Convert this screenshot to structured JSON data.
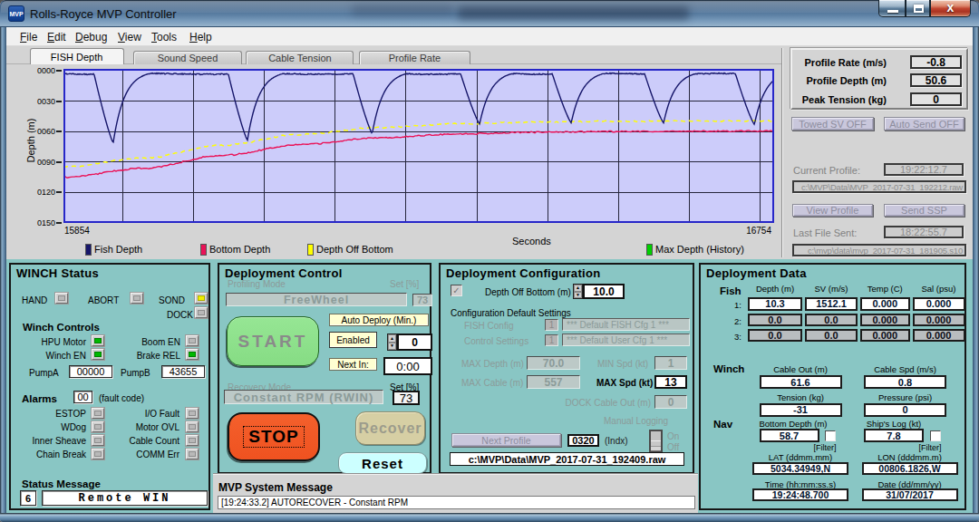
{
  "window": {
    "title": "Rolls-Royce MVP Controller",
    "icon": "MVP",
    "buttons": {
      "minimize": "minimize",
      "maximize": "maximize",
      "close": "close"
    }
  },
  "menu": {
    "items": [
      "File",
      "Edit",
      "Debug",
      "View",
      "Tools",
      "Help"
    ]
  },
  "tabs": [
    {
      "label": "FISH Depth",
      "active": true
    },
    {
      "label": "Sound Speed",
      "active": false
    },
    {
      "label": "Cable Tension",
      "active": false
    },
    {
      "label": "Profile Rate",
      "active": false
    }
  ],
  "chart_data": {
    "type": "line",
    "xlabel": "Seconds",
    "ylabel": "Depth (m)",
    "x_range": [
      15854,
      16754
    ],
    "x_tick_labels": [
      "15854",
      "16754"
    ],
    "y_ticks": [
      "0000",
      "0030",
      "0060",
      "0090",
      "0120",
      "0150"
    ],
    "y_range_m": [
      0,
      150
    ],
    "x_gridlines": 10,
    "plot_bg": "#ccccfa",
    "grid_color": "#26263c",
    "border_color": "#2626c8",
    "series": [
      {
        "name": "Fish Depth",
        "color": "#16166a",
        "surface_depth_m": 3.2,
        "dives": [
          {
            "t": 15917,
            "depth_m": 71.0
          },
          {
            "t": 16087,
            "depth_m": 68.5
          },
          {
            "t": 16245,
            "depth_m": 62.0
          },
          {
            "t": 16381,
            "depth_m": 52.5
          },
          {
            "t": 16497,
            "depth_m": 51.5
          },
          {
            "t": 16614,
            "depth_m": 51.5
          },
          {
            "t": 16729,
            "depth_m": 53.0
          }
        ]
      },
      {
        "name": "Bottom Depth",
        "color": "#ea1257",
        "t": [
          15854,
          15954,
          16054,
          16154,
          16254,
          16354,
          16454,
          16554,
          16654,
          16754
        ],
        "depth_m": [
          105.0,
          96.3,
          83.5,
          72.8,
          66.0,
          62.3,
          60.6,
          59.9,
          59.6,
          59.5
        ]
      },
      {
        "name": "Depth Off Bottom",
        "color": "#ffff00",
        "dashed": true,
        "offset_from_bottom_m": -10
      },
      {
        "name": "Max Depth (History)",
        "color": "#00cf00",
        "visible": false
      }
    ],
    "legend": [
      {
        "label": "Fish Depth",
        "color": "#16166a"
      },
      {
        "label": "Bottom Depth",
        "color": "#ea1257"
      },
      {
        "label": "Depth Off Bottom",
        "color": "#ffff00"
      },
      {
        "label": "Max Depth (History)",
        "color": "#00cf00"
      }
    ]
  },
  "profile_panel": {
    "readouts": [
      {
        "label": "Profile Rate (m/s)",
        "value": "-0.8"
      },
      {
        "label": "Profile Depth (m)",
        "value": "50.6"
      },
      {
        "label": "Peak Tension (kg)",
        "value": "0"
      }
    ],
    "towed_sv_button": "Towed SV OFF",
    "auto_send_button": "Auto Send  OFF",
    "current_profile_label": "Current Profile:",
    "current_profile_time": "19:22:12.7",
    "current_profile_file": "c:\\MVP\\Data\\MVP_2017-07-31_192212.raw",
    "view_profile_button": "View Profile",
    "send_ssp_button": "Send SSP",
    "last_file_label": "Last File Sent:",
    "last_file_time": "18:22:55.7",
    "last_file_path": "c:\\mvp\\data\\mvp_2017-07-31_181905.s10"
  },
  "winch": {
    "title": "WINCH Status",
    "indicators": [
      {
        "label": "HAND",
        "state": "off"
      },
      {
        "label": "ABORT",
        "state": "off"
      },
      {
        "label": "SOND",
        "state": "yellow"
      },
      {
        "label": "DOCK",
        "state": "off"
      }
    ],
    "controls_title": "Winch Controls",
    "controls": [
      {
        "label": "HPU Motor",
        "state": "green"
      },
      {
        "label": "Boom EN",
        "state": "off"
      },
      {
        "label": "Winch EN",
        "state": "green"
      },
      {
        "label": "Brake REL",
        "state": "green"
      }
    ],
    "pump_a_label": "PumpA",
    "pump_a_value": "00000",
    "pump_b_label": "PumpB",
    "pump_b_value": "43655",
    "alarms_title": "Alarms",
    "fault_code": "00",
    "fault_code_note": "(fault code)",
    "alarms": [
      {
        "label": "ESTOP",
        "state": "off"
      },
      {
        "label": "I/O Fault",
        "state": "off"
      },
      {
        "label": "WDog",
        "state": "off"
      },
      {
        "label": "Motor OVL",
        "state": "off"
      },
      {
        "label": "Inner Sheave",
        "state": "off"
      },
      {
        "label": "Cable Count",
        "state": "off"
      },
      {
        "label": "Chain Break",
        "state": "off"
      },
      {
        "label": "COMM Err",
        "state": "off"
      }
    ],
    "status_title": "Status Message",
    "status_code": "6",
    "status_text": "Remote WIN"
  },
  "control": {
    "title": "Deployment Control",
    "profiling_mode_label": "Profiling Mode",
    "profiling_set_label": "Set [%]",
    "profiling_mode": "FreeWheel",
    "profiling_set": "73",
    "start_button": "START",
    "auto_deploy_label": "Auto Deploy (Min.)",
    "enabled_label": "Enabled",
    "auto_deploy_value": "0",
    "next_in_label": "Next In:",
    "next_in_value": "0:00",
    "recovery_mode_label": "Recovery Mode",
    "recovery_set_label": "Set [%]",
    "recovery_mode": "Constant RPM (RWIN)",
    "recovery_set": "73",
    "stop_button": "STOP",
    "recover_button": "Recover",
    "reset_button": "Reset"
  },
  "config": {
    "title": "Deployment Configuration",
    "depth_off_bottom_label": "Depth Off Bottom (m)",
    "depth_off_bottom_checked": true,
    "depth_off_bottom_value": "10.0",
    "defaults_title": "Configuration Default Settings",
    "fish_config_label": "FISH Config",
    "fish_config_index": "1",
    "fish_config_name": "*** Default FISH Cfg 1 ***",
    "control_settings_label": "Control Settings",
    "control_settings_index": "1",
    "control_settings_name": "*** Default User Cfg 1 ***",
    "max_depth_label": "MAX Depth (m)",
    "max_depth_value": "70.0",
    "min_spd_label": "MIN Spd (kt)",
    "min_spd_value": "1",
    "max_cable_label": "MAX Cable (m)",
    "max_cable_value": "557",
    "max_spd_label": "MAX Spd (kt)",
    "max_spd_value": "13",
    "dock_cable_label": "DOCK Cable Out (m)",
    "dock_cable_value": "0",
    "manual_logging_label": "Manual Logging",
    "manual_logging_on": "On",
    "manual_logging_off": "Off",
    "manual_logging_state": "off",
    "next_profile_button": "Next Profile",
    "next_profile_index": "0320",
    "next_profile_index_label": "(Indx)",
    "next_profile_file": "c:\\MVP\\Data\\MVP_2017-07-31_192409.raw"
  },
  "data_panel": {
    "title": "Deployment Data",
    "fish_label": "Fish",
    "fish_headers": [
      "Depth (m)",
      "SV (m/s)",
      "Temp (C)",
      "Sal (psu)"
    ],
    "fish_rows": [
      {
        "index": "1:",
        "values": [
          "10.3",
          "1512.1",
          "0.000",
          "0.000"
        ],
        "active": true
      },
      {
        "index": "2:",
        "values": [
          "0.0",
          "0.0",
          "0.000",
          "0.000"
        ],
        "active": false
      },
      {
        "index": "3:",
        "values": [
          "0.0",
          "0.0",
          "0.000",
          "0.000"
        ],
        "active": false
      }
    ],
    "winch_label": "Winch",
    "winch_fields": [
      {
        "label": "Cable Out (m)",
        "value": "61.6"
      },
      {
        "label": "Cable Spd (m/s)",
        "value": "0.8"
      },
      {
        "label": "Tension (kg)",
        "value": "-31"
      },
      {
        "label": "Pressure (psi)",
        "value": "0"
      }
    ],
    "nav_label": "Nav",
    "nav_fields": [
      {
        "label": "Bottom Depth (m)",
        "value": "58.7",
        "filter": "[Filter]"
      },
      {
        "label": "Ship's Log (kt)",
        "value": "7.8",
        "filter": "[Filter]"
      },
      {
        "label": "LAT (ddmm.mm)",
        "value": "5034.34949,N"
      },
      {
        "label": "LON (dddmm.m)",
        "value": "00806.1826,W"
      },
      {
        "label": "Time (hh:mm:ss.s)",
        "value": "19:24:48.700"
      },
      {
        "label": "Date (dd/mm/yy)",
        "value": "31/07/2017"
      }
    ]
  },
  "system_message": {
    "title": "MVP System Message",
    "text": "[19:24:33.2] AUTORECOVER - Constant RPM"
  }
}
